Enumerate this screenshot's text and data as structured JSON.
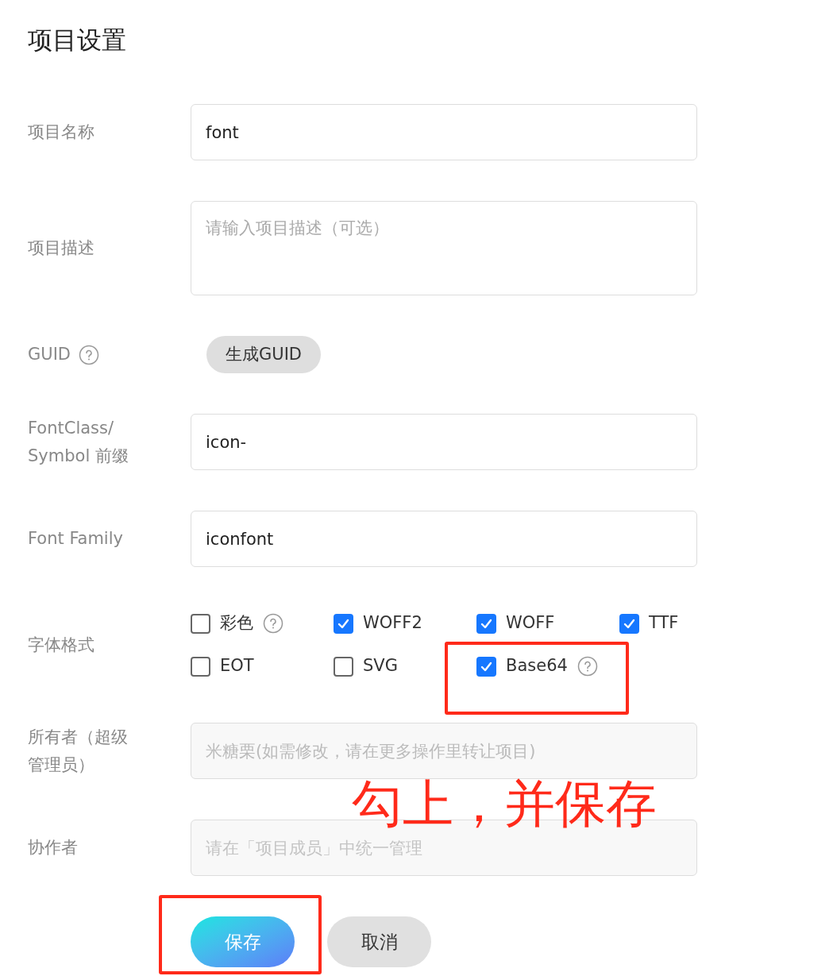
{
  "title": "项目设置",
  "fields": [
    {
      "kind": "input",
      "label": "项目名称",
      "value": "font"
    },
    {
      "kind": "textarea",
      "label": "项目描述",
      "placeholder": "请输入项目描述（可选）"
    },
    {
      "kind": "button",
      "label": "GUID",
      "help": true,
      "button": "生成GUID"
    },
    {
      "kind": "input",
      "label": "FontClass/ Symbol 前缀",
      "value": "icon-"
    },
    {
      "kind": "input",
      "label": "Font Family",
      "value": "iconfont"
    },
    {
      "kind": "checkboxes",
      "label": "字体格式",
      "options": [
        {
          "label": "彩色",
          "checked": false,
          "help": true,
          "highlighted": false
        },
        {
          "label": "WOFF2",
          "checked": true,
          "help": false,
          "highlighted": false
        },
        {
          "label": "WOFF",
          "checked": true,
          "help": false,
          "highlighted": false
        },
        {
          "label": "TTF",
          "checked": true,
          "help": false,
          "highlighted": false
        },
        {
          "label": "EOT",
          "checked": false,
          "help": false,
          "highlighted": false
        },
        {
          "label": "SVG",
          "checked": false,
          "help": false,
          "highlighted": false
        },
        {
          "label": "Base64",
          "checked": true,
          "help": true,
          "highlighted": true
        }
      ]
    },
    {
      "kind": "input",
      "label": "所有者（超级管理员）",
      "value": "米糖栗(如需修改，请在更多操作里转让项目)",
      "disabled": true
    },
    {
      "kind": "input",
      "label": "协作者",
      "placeholder": "请在「项目成员」中统一管理",
      "disabled": true
    }
  ],
  "actions": [
    {
      "label": "保存",
      "kind": "primary",
      "highlighted": true
    },
    {
      "label": "取消",
      "kind": "secondary",
      "highlighted": false
    }
  ],
  "note": "勾上，并保存"
}
